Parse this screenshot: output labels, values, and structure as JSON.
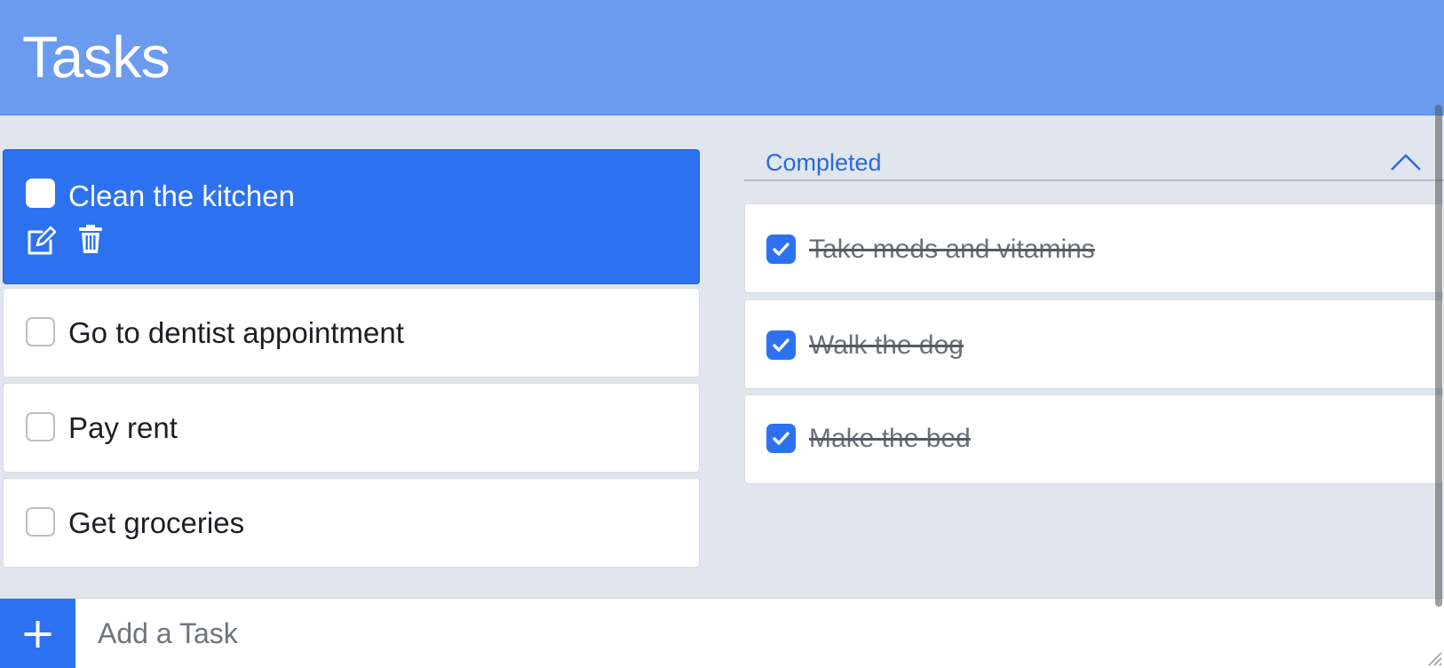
{
  "header": {
    "title": "Tasks"
  },
  "tasks": [
    {
      "label": "Clean the kitchen",
      "selected": true
    },
    {
      "label": "Go to dentist appointment",
      "selected": false
    },
    {
      "label": "Pay rent",
      "selected": false
    },
    {
      "label": "Get groceries",
      "selected": false
    }
  ],
  "completed": {
    "label": "Completed",
    "items": [
      {
        "label": "Take meds and vitamins"
      },
      {
        "label": "Walk the dog"
      },
      {
        "label": "Make the bed"
      }
    ]
  },
  "add_task": {
    "placeholder": "Add a Task",
    "value": ""
  },
  "colors": {
    "header": "#6a9bef",
    "accent": "#2c72f0",
    "background": "#e1e5ed",
    "completed_label": "#2a6ad9"
  },
  "icons": {
    "edit": "edit-icon",
    "delete": "trash-icon",
    "collapse": "chevron-up-icon",
    "add": "plus-icon",
    "check": "checkmark-icon"
  }
}
